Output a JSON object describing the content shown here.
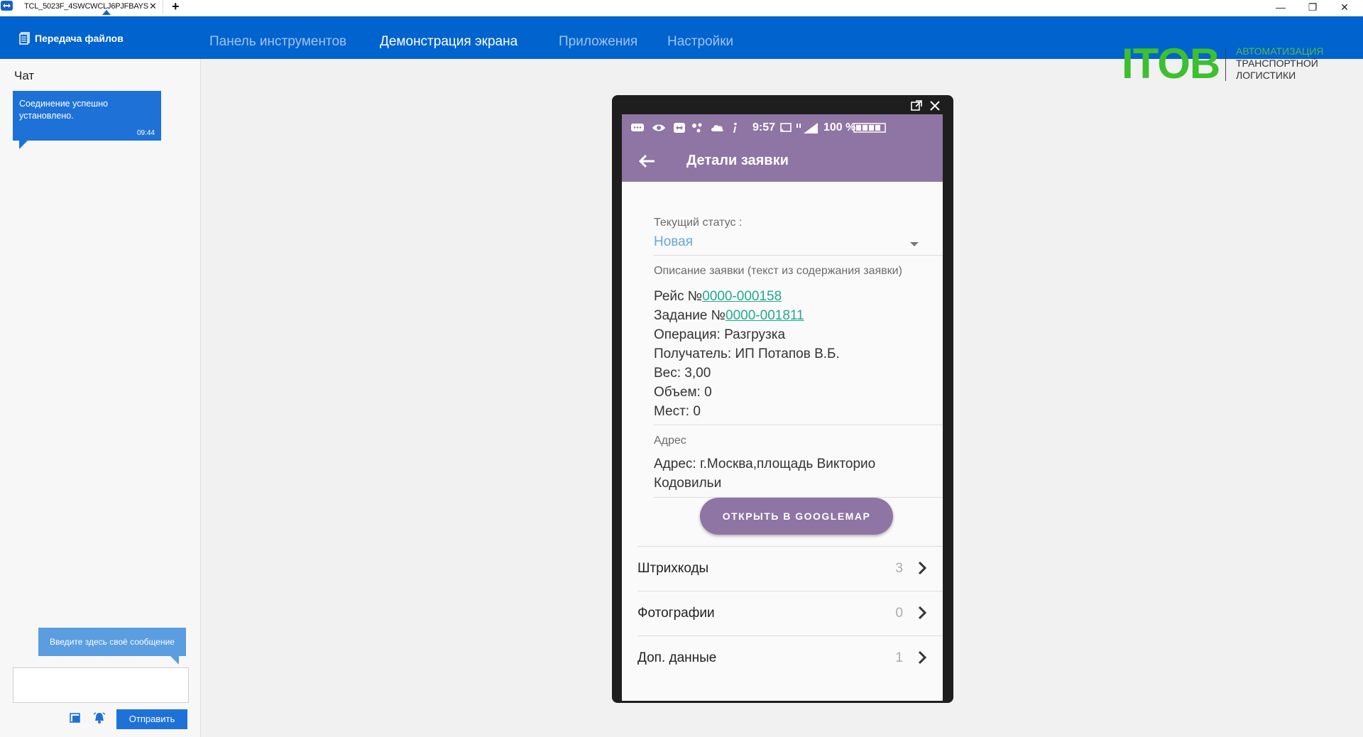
{
  "titlebar": {
    "tab_label": "TCL_5023F_4SWCWCLJ6PJFBAYS",
    "close_glyph": "✕",
    "add_glyph": "+",
    "minimize_glyph": "—",
    "restore_glyph": "❐",
    "window_close_glyph": "✕"
  },
  "header": {
    "file_transfer": "Передача файлов",
    "nav": [
      {
        "label": "Панель инструментов",
        "active": false
      },
      {
        "label": "Демонстрация экрана",
        "active": true
      },
      {
        "label": "Приложения",
        "active": false
      },
      {
        "label": "Настройки",
        "active": false
      }
    ],
    "brand": {
      "name": "ITOB",
      "line1": "АВТОМАТИЗАЦИЯ",
      "line2": "ТРАНСПОРТНОЙ",
      "line3": "ЛОГИСТИКИ"
    }
  },
  "chat": {
    "title": "Чат",
    "message_text": "Соединение успешно установлено.",
    "message_time": "09:44",
    "input_hint": "Введите здесь своё сообщение",
    "send_label": "Отправить"
  },
  "phone": {
    "status_time": "9:57",
    "battery": "100 %",
    "title": "Детали заявки",
    "status_label": "Текущий статус :",
    "status_value": "Новая",
    "desc_label": "Описание заявки (текст из содержания заявки)",
    "trip_prefix": "Рейс №",
    "trip_number": "0000-000158",
    "task_prefix": "Задание №",
    "task_number": "0000-001811",
    "operation": "Операция: Разгрузка",
    "recipient": "Получатель: ИП Потапов В.Б.",
    "weight": "Вес: 3,00",
    "volume": "Объем: 0",
    "places": "Мест: 0",
    "address_label": "Адрес",
    "address_line1": "Адрес: г.Москва,площадь Викторио",
    "address_line2": "Кодовильи",
    "map_button": "ОТКРЫТЬ В GOOGLEMAP",
    "rows": [
      {
        "label": "Штрихкоды",
        "count": "3"
      },
      {
        "label": "Фотографии",
        "count": "0"
      },
      {
        "label": "Доп. данные",
        "count": "1"
      }
    ]
  },
  "colors": {
    "header_blue": "#0063ce",
    "phone_purple": "#8e75a4",
    "brand_green": "#3dbf2f",
    "link_green": "#22a98f",
    "status_blue": "#64a7d8"
  }
}
